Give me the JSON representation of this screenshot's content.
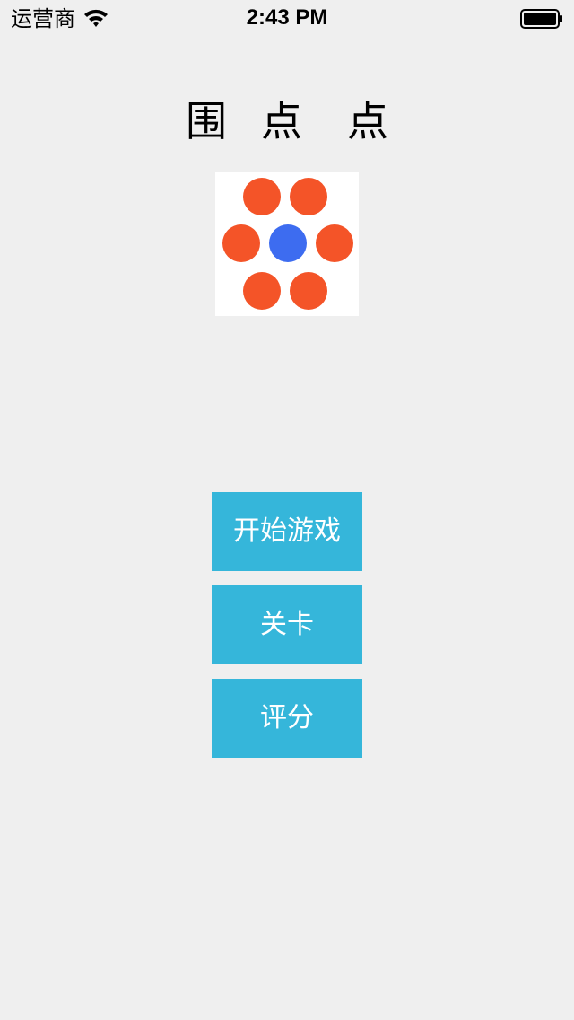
{
  "status_bar": {
    "carrier": "运营商",
    "time": "2:43 PM",
    "wifi_icon": "wifi-icon",
    "battery_icon": "battery-icon"
  },
  "title": {
    "chars": [
      "围",
      "点",
      "点"
    ]
  },
  "logo": {
    "outer_color": "#f45428",
    "center_color": "#3d6cf0"
  },
  "menu": {
    "start_label": "开始游戏",
    "levels_label": "关卡",
    "rate_label": "评分",
    "button_color": "#35b6da"
  }
}
